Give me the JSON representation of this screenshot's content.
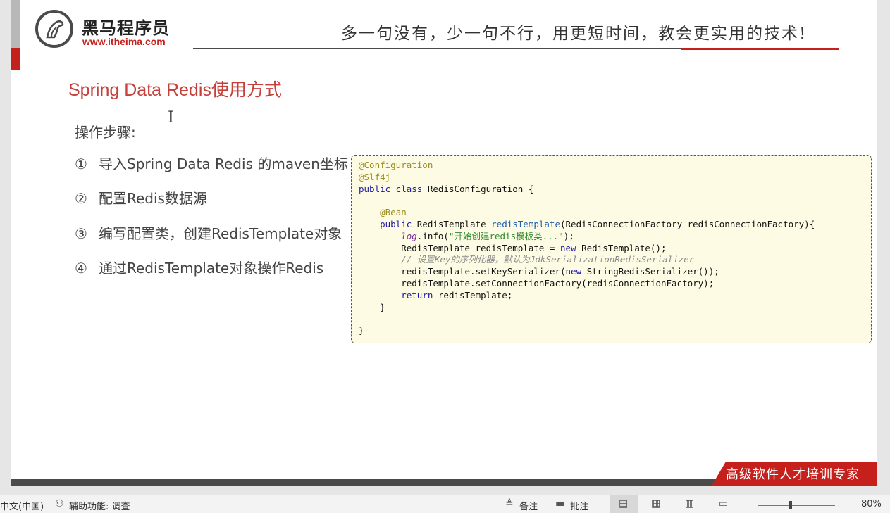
{
  "header": {
    "logo_name": "黑马程序员",
    "logo_url": "www.itheima.com",
    "slogan": "多一句没有，少一句不行，用更短时间，教会更实用的技术!"
  },
  "slide": {
    "title": "Spring Data Redis使用方式",
    "steps_label": "操作步骤:",
    "steps": [
      {
        "num": "①",
        "text": "导入Spring Data Redis 的maven坐标"
      },
      {
        "num": "②",
        "text": "配置Redis数据源"
      },
      {
        "num": "③",
        "text": "编写配置类，创建RedisTemplate对象"
      },
      {
        "num": "④",
        "text": "通过RedisTemplate对象操作Redis"
      }
    ],
    "code": {
      "annotation_configuration": "@Configuration",
      "annotation_slf4j": "@Slf4j",
      "class_decl_kw": "public class",
      "class_name": " RedisConfiguration {",
      "annotation_bean": "@Bean",
      "method_kw": "public",
      "method_return": " RedisTemplate ",
      "method_name": "redisTemplate",
      "method_params": "(RedisConnectionFactory redisConnectionFactory){",
      "log_var": "log",
      "log_call": ".info(",
      "log_string": "\"开始创建redis模板类...\"",
      "log_end": ");",
      "decl_start": "RedisTemplate redisTemplate = ",
      "new_kw": "new",
      "decl_end": " RedisTemplate();",
      "comment": "// 设置Key的序列化器，默认为JdkSerializationRedisSerializer",
      "set_key_start": "redisTemplate.setKeySerializer(",
      "set_key_end": " StringRedisSerializer());",
      "set_factory": "redisTemplate.setConnectionFactory(redisConnectionFactory);",
      "return_kw": "return",
      "return_val": " redisTemplate;",
      "close_method": "}",
      "close_class": "}"
    },
    "bottom_slogan": "高级软件人才培训专家"
  },
  "statusbar": {
    "language": "中文(中国)",
    "accessibility": "辅助功能: 调查",
    "notes": "备注",
    "comments": "批注",
    "zoom": "80%"
  },
  "colors": {
    "brand_red": "#c5201c",
    "title_red": "#c5403b",
    "code_bg": "#fdfbe4"
  }
}
